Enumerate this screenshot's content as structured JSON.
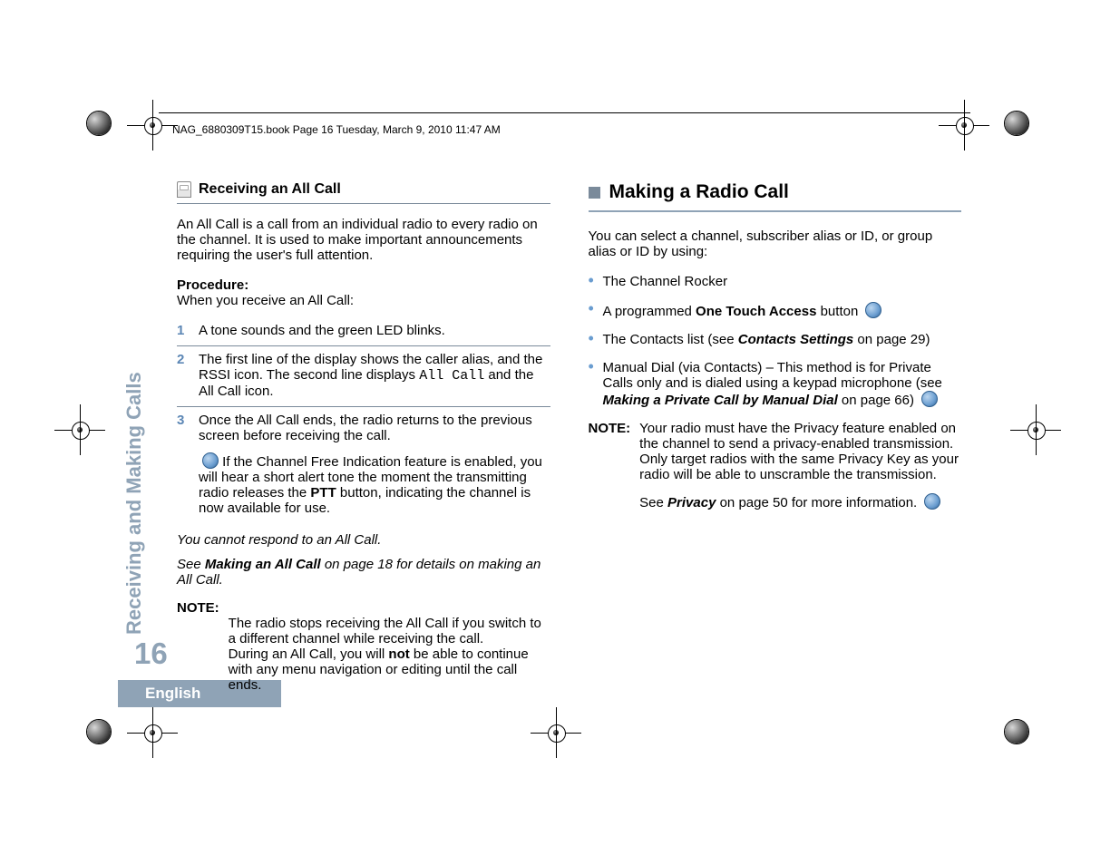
{
  "header": "NAG_6880309T15.book  Page 16  Tuesday, March 9, 2010  11:47 AM",
  "sidebar": {
    "section": "Receiving and Making Calls",
    "page": "16",
    "language": "English"
  },
  "left": {
    "heading": "Receiving an All Call",
    "intro": "An All Call is a call from an individual radio to every radio on the channel. It is used to make important announcements requiring the user's full attention.",
    "procedure_label": "Procedure:",
    "procedure_text": "When you receive an All Call:",
    "steps": {
      "1": "A tone sounds and the green LED blinks.",
      "2_pre": "The first line of the display shows the caller alias, and the RSSI icon. The second line displays ",
      "2_mono": "All Call",
      "2_post": " and the All Call icon.",
      "3_main": "Once the All Call ends, the radio returns to the previous screen before receiving the call.",
      "3_extra_pre": " If the Channel Free Indication feature is enabled, you will hear a short alert tone the moment the transmitting radio releases the ",
      "3_ptt": "PTT",
      "3_extra_post": " button, indicating the channel is now available for use."
    },
    "italic1": "You cannot respond to an All Call.",
    "italic2_pre": "See ",
    "italic2_link": "Making an All Call",
    "italic2_post": " on page 18 for details on making an All Call.",
    "note_label": "NOTE:",
    "note_body_pre": "The radio stops receiving the All Call if you switch to a different channel while receiving the call.\nDuring an All Call, you will ",
    "note_not": "not",
    "note_body_post": " be able to continue with any menu navigation or editing until the call ends."
  },
  "right": {
    "heading": "Making a Radio Call",
    "intro": "You can select a channel, subscriber alias or ID, or group alias or ID by using:",
    "bullets": {
      "1": "The Channel Rocker",
      "2_pre": "A programmed ",
      "2_bold": "One Touch Access",
      "2_post": " button",
      "3_pre": "The Contacts list (see ",
      "3_link": "Contacts Settings",
      "3_post": " on page 29)",
      "4_pre": "Manual Dial (via Contacts) – This method is for Private Calls only and is dialed using a keypad microphone (see ",
      "4_link": "Making a Private Call by Manual Dial",
      "4_post": " on page 66)"
    },
    "note_label": "NOTE:",
    "note_line1": "Your radio must have the Privacy feature enabled on the channel to send a privacy-enabled transmission. Only target radios with the same Privacy Key as your radio will be able to unscramble the transmission.",
    "note_line2_pre": "See ",
    "note_line2_link": "Privacy",
    "note_line2_post": " on page 50 for more information."
  }
}
